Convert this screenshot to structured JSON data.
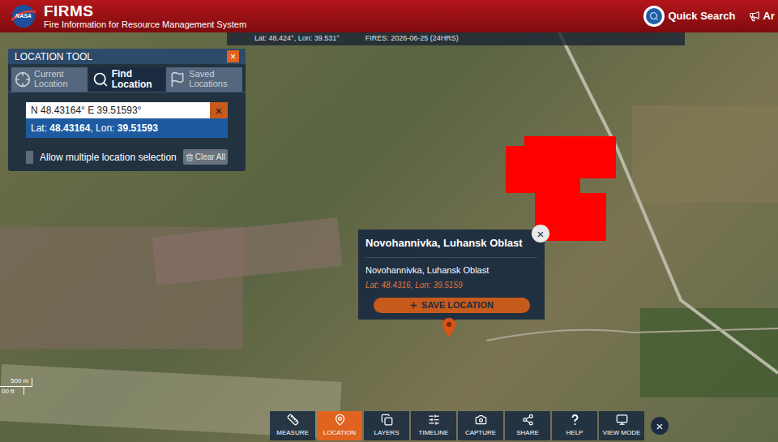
{
  "header": {
    "logo": "NASA",
    "title": "FIRMS",
    "subtitle": "Fire Information for Resource Management System",
    "quickSearch": "Quick Search",
    "alerts": "Ar"
  },
  "coordBar": {
    "position": "Lat: 48.424°, Lon: 39.531°",
    "fires": "FIRES: 2026-06-25 (24HRS)"
  },
  "locationTool": {
    "title": "LOCATION TOOL",
    "close": "×",
    "tabs": [
      {
        "label": "Current Location",
        "selected": false
      },
      {
        "label": "Find Location",
        "selected": true
      },
      {
        "label": "Saved Locations",
        "selected": false
      }
    ],
    "input": {
      "value": "N 48.43164° E 39.51593°",
      "clear": "×"
    },
    "result": {
      "latLabel": "Lat: ",
      "lat": "48.43164",
      "lonLabel": ", Lon: ",
      "lon": "39.51593"
    },
    "multiple": {
      "label": "Allow multiple location selection",
      "checked": false
    },
    "clearAll": "Clear All"
  },
  "popup": {
    "title": "Novohannivka, Luhansk Oblast",
    "close": "×",
    "place": "Novohannivka, Luhansk Oblast",
    "coords": "Lat: 48.4316, Lon: 39.5159",
    "save": "SAVE LOCATION"
  },
  "scale": {
    "metric": "500 m",
    "imperial": "00 ft"
  },
  "toolbar": {
    "items": [
      {
        "label": "MEASURE",
        "selected": false
      },
      {
        "label": "LOCATION",
        "selected": true
      },
      {
        "label": "LAYERS",
        "selected": false
      },
      {
        "label": "TIMELINE",
        "selected": false
      },
      {
        "label": "CAPTURE",
        "selected": false
      },
      {
        "label": "SHARE",
        "selected": false
      },
      {
        "label": "HELP",
        "selected": false
      },
      {
        "label": "VIEW MODE",
        "selected": false
      }
    ],
    "close": "×"
  }
}
